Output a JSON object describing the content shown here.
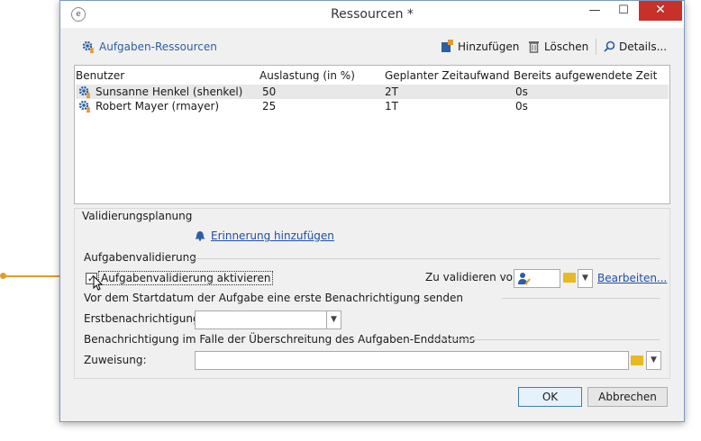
{
  "window": {
    "title": "Ressourcen *",
    "app_icon": "e",
    "minimize": "—",
    "maximize": "☐",
    "close": "✕"
  },
  "toolbar": {
    "title": "Aufgaben-Ressourcen",
    "add_label": "Hinzufügen",
    "delete_label": "Löschen",
    "details_label": "Details..."
  },
  "table": {
    "headers": [
      "Benutzer",
      "Auslastung (in %)",
      "Geplanter Zeitaufwand",
      "Bereits aufgewendete Zeit"
    ],
    "rows": [
      {
        "user": "Sunsanne Henkel (shenkel)",
        "load": "50",
        "planned": "2T",
        "spent": "0s"
      },
      {
        "user": "Robert Mayer (rmayer)",
        "load": "25",
        "planned": "1T",
        "spent": "0s"
      }
    ]
  },
  "validation": {
    "section_title": "Validierungsplanung",
    "reminder_link": "Erinnerung hinzufügen",
    "task_validation_title": "Aufgabenvalidierung",
    "enable_label": "Aufgabenvalidierung aktivieren",
    "enable_checked": true,
    "validate_by_label": "Zu validieren von:",
    "edit_link": "Bearbeiten...",
    "first_notification_title": "Vor dem Startdatum der Aufgabe eine erste Benachrichtigung senden",
    "first_notification_label": "Erstbenachrichtigung:",
    "first_notification_value": "",
    "overdue_title": "Benachrichtigung im Falle der Überschreitung des Aufgaben-Enddatums",
    "assignment_label": "Zuweisung:",
    "assignment_value": ""
  },
  "buttons": {
    "ok": "OK",
    "cancel": "Abbrechen"
  },
  "colors": {
    "accent": "#2b5fa5",
    "link": "#1d4fa8",
    "close": "#c7312a",
    "arrow": "#e39a2d"
  }
}
